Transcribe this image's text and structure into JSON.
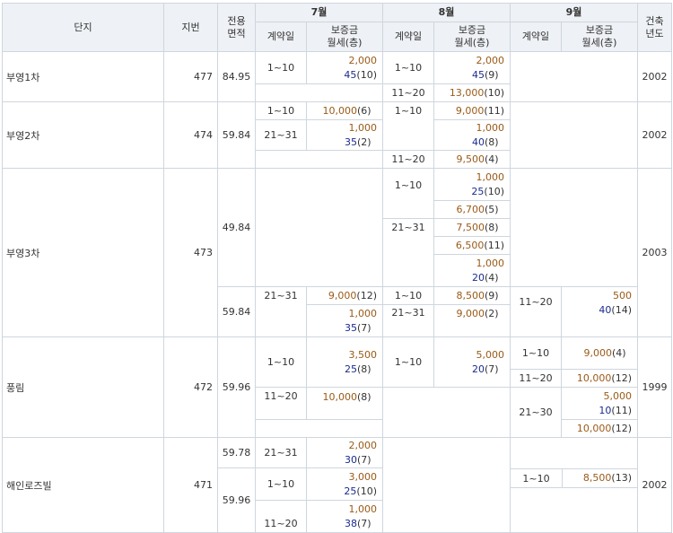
{
  "headers": {
    "complex": "단지",
    "lot": "지번",
    "area": "전용\n면적",
    "built": "건축\n년도",
    "months": [
      "7월",
      "8월",
      "9월"
    ],
    "contract_date": "계약일",
    "deposit_rent": "보증금\n월세(층)"
  },
  "complexes": [
    {
      "name": "부영1차",
      "lot": "477",
      "year": "2002"
    },
    {
      "name": "부영2차",
      "lot": "474",
      "year": "2002"
    },
    {
      "name": "부영3차",
      "lot": "473",
      "year": "2003"
    },
    {
      "name": "풍림",
      "lot": "472",
      "year": "1999"
    },
    {
      "name": "해인로즈빌",
      "lot": "471",
      "year": "2002"
    }
  ],
  "areas": {
    "a1": "84.95",
    "a2": "59.84",
    "a3a": "49.84",
    "a3b": "59.84",
    "a4": "59.96",
    "a5a": "59.78",
    "a5b": "59.96"
  },
  "deals": {
    "b1_jul_1": {
      "date": "1~10",
      "deposit": "2,000",
      "rent": "45",
      "floor": "(10)"
    },
    "b1_aug_1": {
      "date": "1~10",
      "deposit": "2,000",
      "rent": "45",
      "floor": "(9)"
    },
    "b1_aug_2": {
      "date": "11~20",
      "deposit": "13,000",
      "floor": "(10)"
    },
    "b2_jul_1": {
      "date": "1~10",
      "deposit": "10,000",
      "floor": "(6)"
    },
    "b2_jul_2": {
      "date": "21~31",
      "deposit": "1,000",
      "rent": "35",
      "floor": "(2)"
    },
    "b2_aug_1": {
      "date": "1~10",
      "deposit": "9,000",
      "floor": "(11)"
    },
    "b2_aug_2": {
      "deposit": "1,000",
      "rent": "40",
      "floor": "(8)"
    },
    "b2_aug_3": {
      "date": "11~20",
      "deposit": "9,500",
      "floor": "(4)"
    },
    "b3_aug_1": {
      "date": "1~10",
      "deposit": "1,000",
      "rent": "25",
      "floor": "(10)"
    },
    "b3_aug_2": {
      "deposit": "6,700",
      "floor": "(5)"
    },
    "b3_aug_3": {
      "date": "21~31",
      "deposit": "7,500",
      "floor": "(8)"
    },
    "b3_aug_4": {
      "deposit": "6,500",
      "floor": "(11)"
    },
    "b3_aug_5": {
      "deposit": "1,000",
      "rent": "20",
      "floor": "(4)"
    },
    "b3b_jul_1": {
      "date": "21~31",
      "deposit": "9,000",
      "floor": "(12)"
    },
    "b3b_jul_2": {
      "deposit": "1,000",
      "rent": "35",
      "floor": "(7)"
    },
    "b3b_aug_1": {
      "date": "1~10",
      "deposit": "8,500",
      "floor": "(9)"
    },
    "b3b_aug_2": {
      "date": "21~31",
      "deposit": "9,000",
      "floor": "(2)"
    },
    "b3b_sep_1": {
      "date": "11~20",
      "deposit": "500",
      "rent": "40",
      "floor": "(14)"
    },
    "p_jul_1": {
      "date": "1~10",
      "deposit": "3,500",
      "rent": "25",
      "floor": "(8)"
    },
    "p_jul_2": {
      "date": "11~20",
      "deposit": "10,000",
      "floor": "(8)"
    },
    "p_aug_1": {
      "date": "1~10",
      "deposit": "5,000",
      "rent": "20",
      "floor": "(7)"
    },
    "p_sep_1": {
      "date": "1~10",
      "deposit": "9,000",
      "floor": "(4)"
    },
    "p_sep_2": {
      "date": "11~20",
      "deposit": "10,000",
      "floor": "(12)"
    },
    "p_sep_3": {
      "date": "21~30",
      "deposit": "5,000",
      "rent": "10",
      "floor": "(11)"
    },
    "p_sep_4": {
      "deposit": "10,000",
      "floor": "(12)"
    },
    "h_jul_1": {
      "date": "21~31",
      "deposit": "2,000",
      "rent": "30",
      "floor": "(7)"
    },
    "h_jul_2": {
      "date": "1~10",
      "deposit": "3,000",
      "rent": "25",
      "floor": "(10)"
    },
    "h_jul_3": {
      "date": "11~20",
      "deposit": "1,000",
      "rent": "38",
      "floor": "(7)"
    },
    "h_sep_1": {
      "date": "1~10",
      "deposit": "8,500",
      "floor": "(13)"
    }
  },
  "colors": {
    "deposit": "#9a5a17",
    "rent": "#1b2b8f",
    "header_bg": "#eef1f5",
    "border": "#cfd6de"
  }
}
